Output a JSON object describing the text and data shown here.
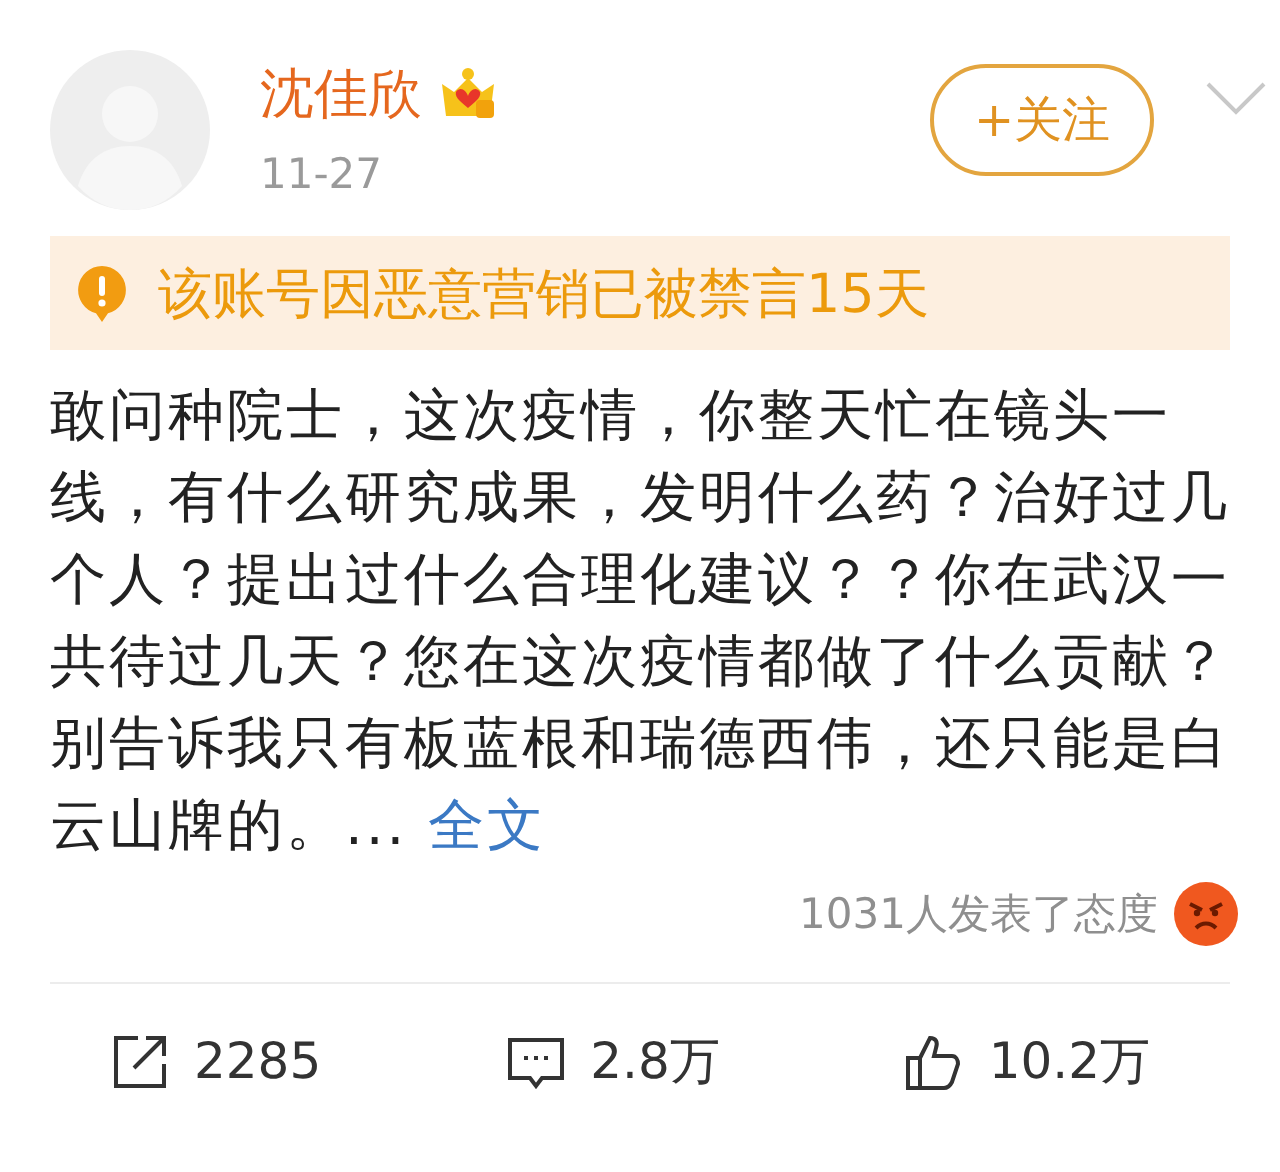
{
  "author": {
    "name": "沈佳欣",
    "date": "11-27"
  },
  "follow_button": {
    "label": "+关注"
  },
  "notice": {
    "text": "该账号因恶意营销已被禁言15天"
  },
  "post": {
    "text": "敢问种院士，这次疫情，你整天忙在镜头一线，有什么研究成果，发明什么药？治好过几个人？提出过什么合理化建议？？你在武汉一共待过几天？您在这次疫情都做了什么贡献？别告诉我只有板蓝根和瑞德西伟，还只能是白云山牌的。...",
    "link": "全文"
  },
  "reactions": {
    "text": "1031人发表了态度"
  },
  "actions": [
    {
      "kind": "repost",
      "count": "2285"
    },
    {
      "kind": "comment",
      "count": "2.8万"
    },
    {
      "kind": "like",
      "count": "10.2万"
    }
  ]
}
